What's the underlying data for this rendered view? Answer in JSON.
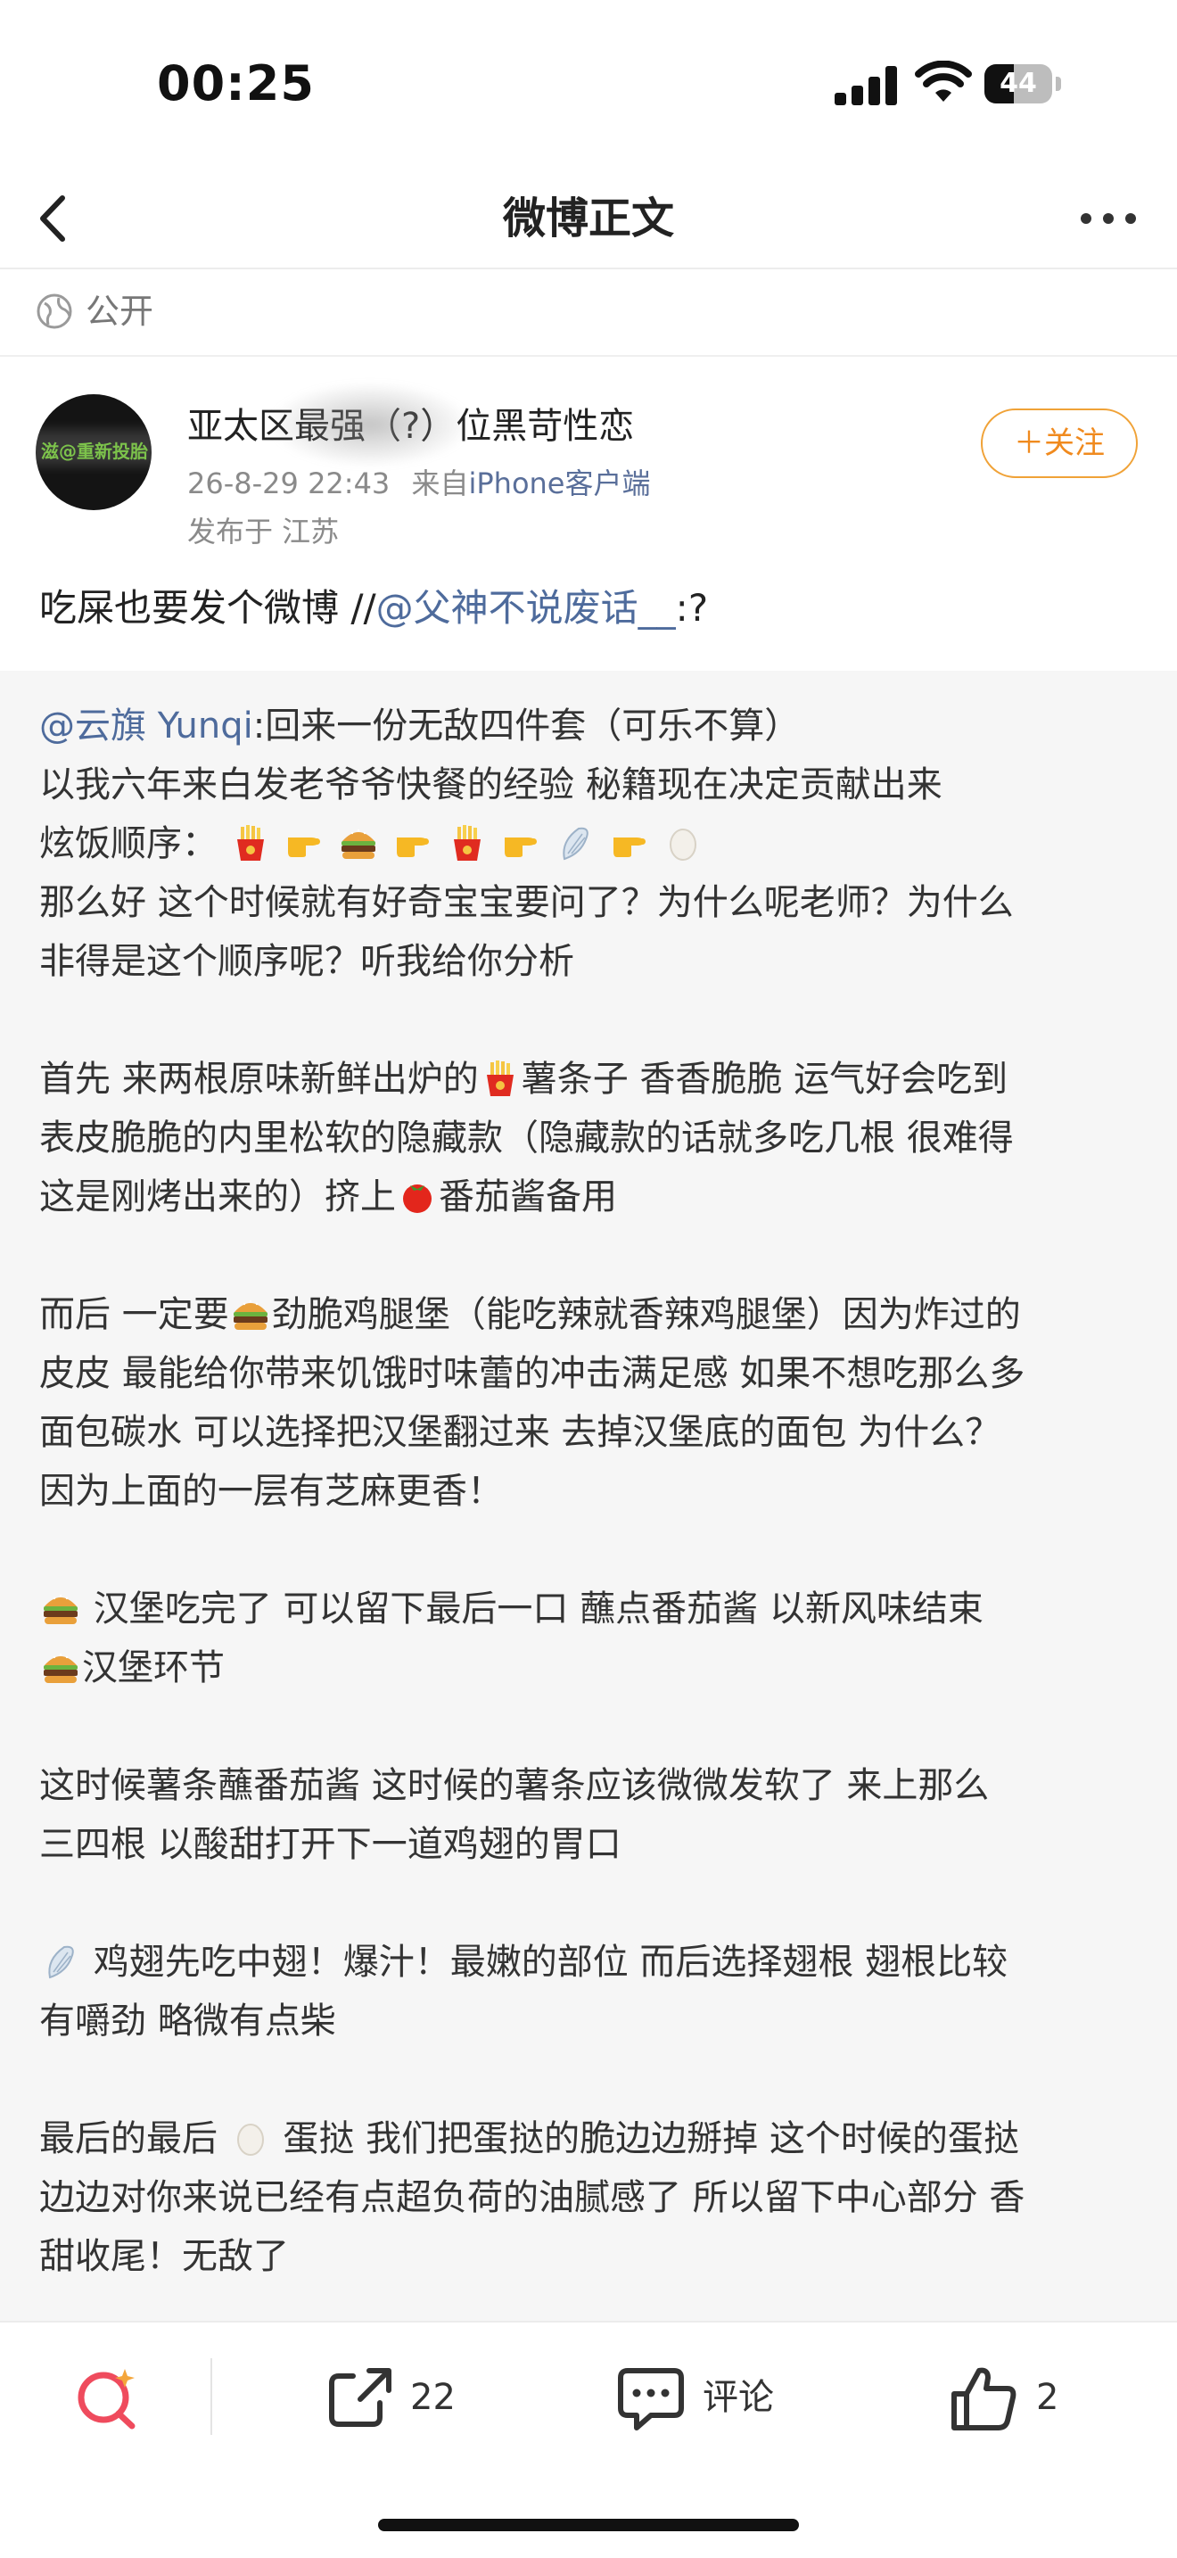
{
  "status_bar": {
    "time": "00:25",
    "battery": "44"
  },
  "nav": {
    "title": "微博正文"
  },
  "visibility": {
    "label": "公开"
  },
  "author": {
    "avatar_text": "滋@重新投胎",
    "name": "亚太区最强（?）位黑苛性恋",
    "timestamp": "26-8-29 22:43",
    "source_prefix": "来自",
    "source": "iPhone客户端",
    "location": "发布于 江苏",
    "follow_label": "＋关注"
  },
  "post": {
    "text_prefix": "吃屎也要发个微博 //",
    "mention": "@父神不说废话__",
    "text_suffix": ":?"
  },
  "retweet": {
    "mention": "@云旗 Yunqi",
    "lines": [
      ":回来一份无敌四件套（可乐不算）",
      "以我六年来白发老爷爷快餐的经验 秘籍现在决定贡献出来",
      "炫饭顺序：",
      "那么好 这个时候就有好奇宝宝要问了？为什么呢老师？为什么",
      "非得是这个顺序呢？听我给你分析",
      "首先 来两根原味新鲜出炉的",
      "薯条子 香香脆脆 运气好会吃到",
      "表皮脆脆的内里松软的隐藏款（隐藏款的话就多吃几根 很难得",
      "这是刚烤出来的）挤上",
      "番茄酱备用",
      "而后 一定要",
      "劲脆鸡腿堡（能吃辣就香辣鸡腿堡）因为炸过的",
      "皮皮 最能给你带来饥饿时味蕾的冲击满足感 如果不想吃那么多",
      "面包碳水 可以选择把汉堡翻过来 去掉汉堡底的面包 为什么？",
      "因为上面的一层有芝麻更香！",
      " 汉堡吃完了 可以留下最后一口 蘸点番茄酱 以新风味结束",
      "汉堡环节",
      " 这时候薯条蘸番茄酱 这时候的薯条应该微微发软了 来上那么",
      "三四根 以酸甜打开下一道鸡翅的胃口",
      " 鸡翅先吃中翅！爆汁！最嫩的部位  而后选择翅根 翅根比较",
      "有嚼劲 略微有点柴",
      "最后的最后 ",
      " 蛋挞 我们把蛋挞的脆边边掰掉 这个时候的蛋挞",
      "边边对你来说已经有点超负荷的油腻感了 所以留下中心部分 香",
      "甜收尾！无敌了"
    ]
  },
  "toolbar": {
    "share_count": "22",
    "comment_label": "评论",
    "like_count": "2"
  },
  "icons": {
    "emoji_sequence": [
      "fries-emoji",
      "point-right-emoji",
      "burger-emoji",
      "point-right-emoji",
      "fries-emoji",
      "point-right-emoji",
      "wing-emoji",
      "point-right-emoji",
      "egg-tart-emoji"
    ]
  },
  "colors": {
    "accent": "#f08a1e",
    "link": "#4e6b9c",
    "quote_bg": "#f6f6f6"
  }
}
